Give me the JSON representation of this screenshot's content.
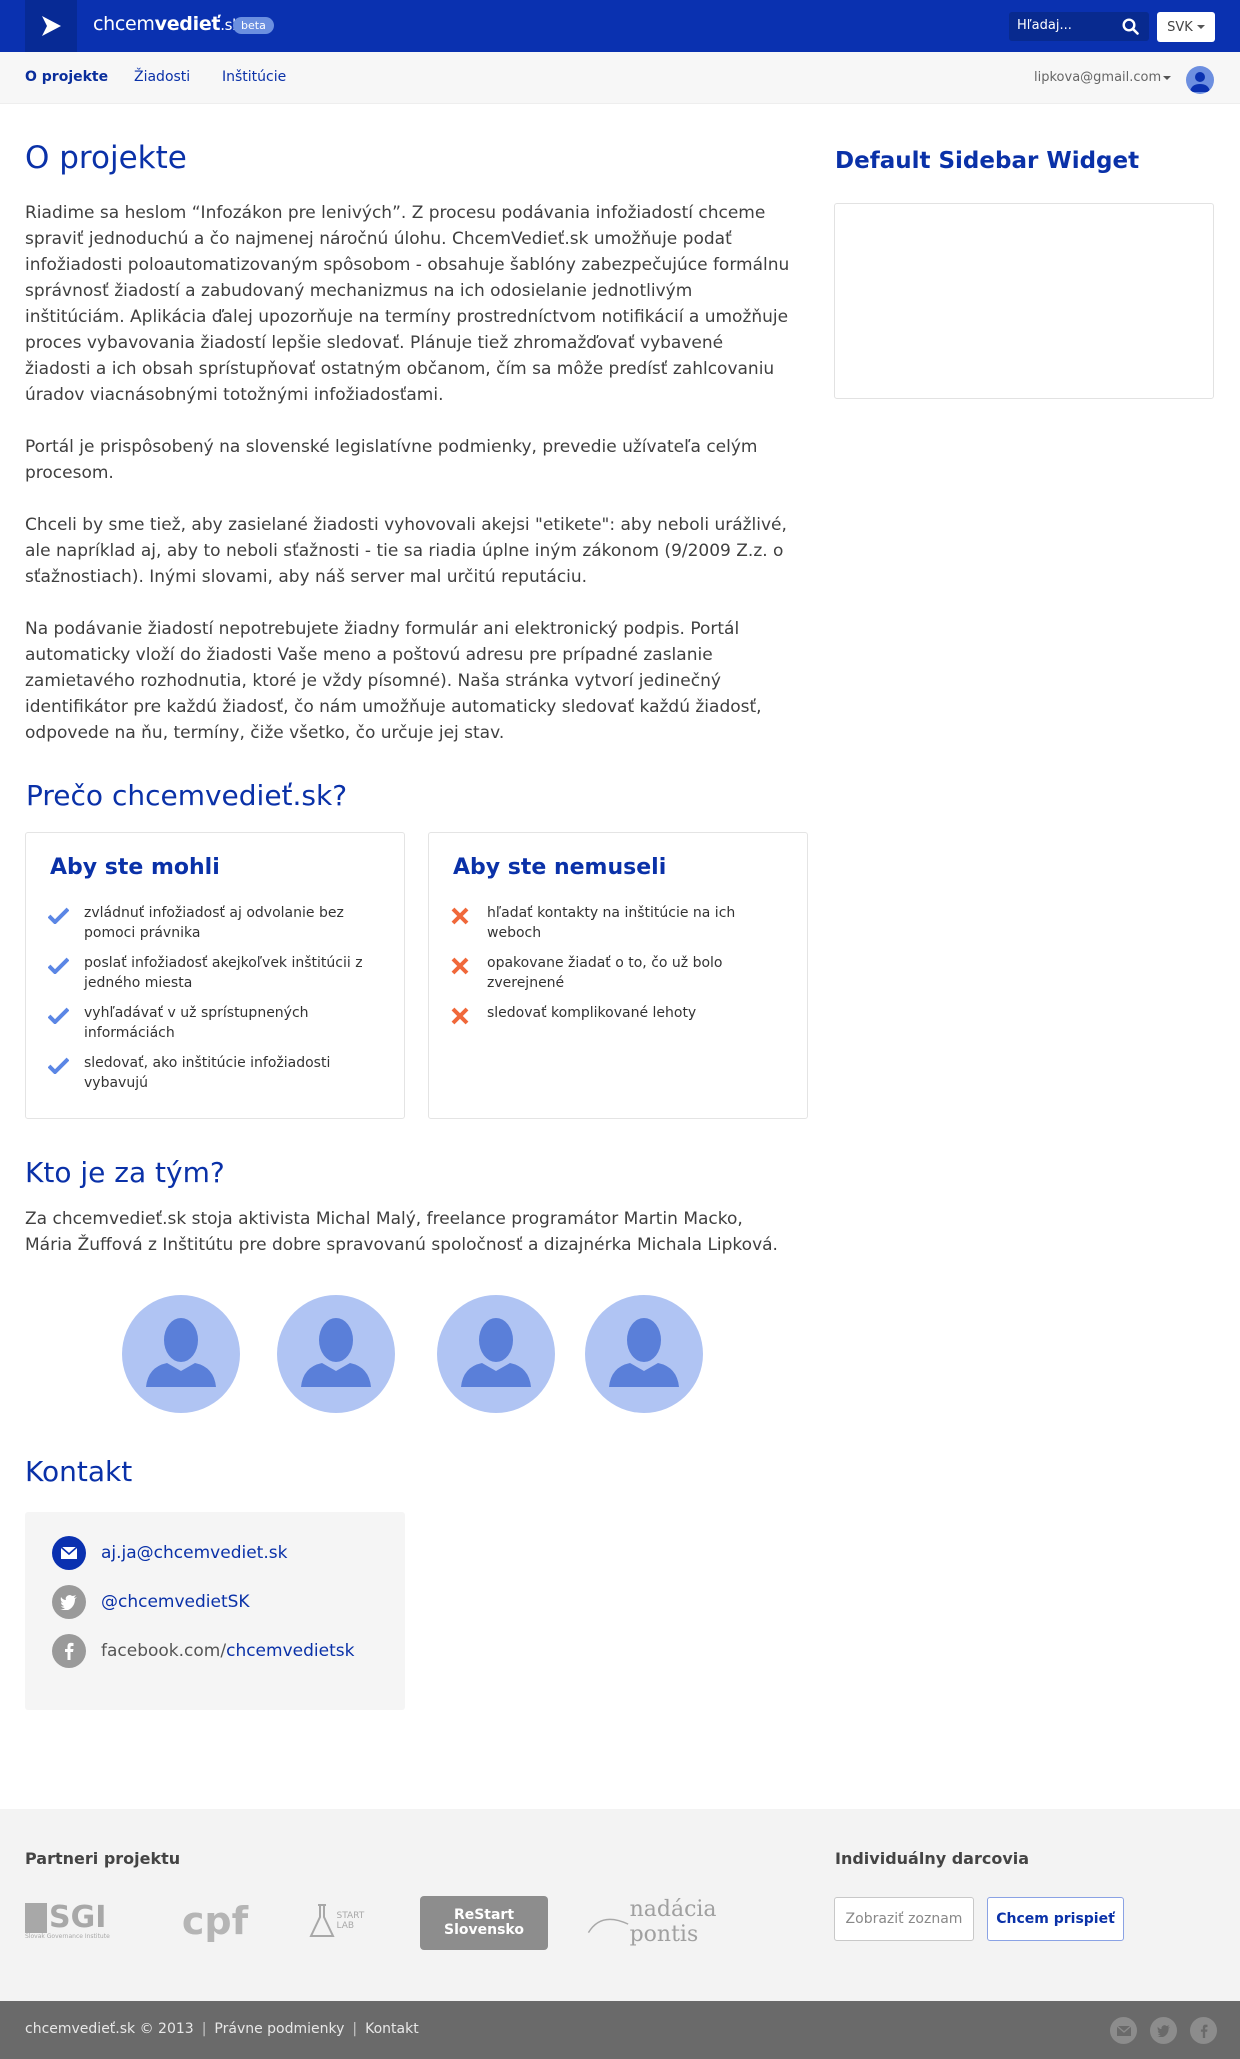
{
  "header": {
    "brand_light": "chcem",
    "brand_bold": "vedieť",
    "brand_tld": ".sk",
    "beta_label": "beta",
    "search_placeholder": "Hľadaj...",
    "lang_label": "SVK"
  },
  "nav": {
    "items": [
      {
        "label": "O projekte",
        "active": true
      },
      {
        "label": "Žiadosti"
      },
      {
        "label": "Inštitúcie"
      }
    ],
    "user_email": "lipkova@gmail.com"
  },
  "main": {
    "title": "O projekte",
    "paragraphs": [
      "Riadime sa heslom “Infozákon pre lenivých”. Z procesu podávania infožiadostí chceme spraviť jednoduchú a čo najmenej náročnú úlohu. ChcemVedieť.sk umožňuje podať infožiadosti poloautomatizovaným spôsobom - obsahuje šablóny zabezpečujúce formálnu správnosť žiadostí a zabudovaný mechanizmus na ich odosielanie jednotlivým inštitúciám. Aplikácia ďalej upozorňuje na termíny prostredníctvom notifikácií a umožňuje proces vybavovania žiadostí lepšie sledovať. Plánuje tiež zhromažďovať vybavené žiadosti a ich obsah sprístupňovať ostatným občanom, čím sa môže predísť zahlcovaniu úradov viacnásobnými totožnými infožiadosťami.",
      "Portál je prispôsobený na slovenské legislatívne podmienky, prevedie užívateľa celým procesom.",
      "Chceli by sme tiež, aby zasielané žiadosti vyhovovali akejsi \"etikete\": aby  neboli urážlivé, ale napríklad aj, aby to neboli sťažnosti - tie sa riadia úplne iným zákonom (9/2009 Z.z. o sťažnostiach). Inými slovami, aby náš server mal určitú reputáciu.",
      "Na podávanie žiadostí nepotrebujete žiadny formulár ani elektronický podpis. Portál automaticky vloží do žiadosti Vaše meno a poštovú adresu pre prípadné zaslanie zamietavého rozhodnutia, ktoré je vždy písomné). Naša stránka vytvorí jedinečný identifikátor pre každú žiadosť, čo nám umožňuje automaticky sledovať každú žiadosť, odpovede na ňu, termíny, čiže všetko, čo určuje jej stav."
    ],
    "why_title": "Prečo chcemvedieť.sk?",
    "can_card": {
      "title": "Aby ste mohli",
      "items": [
        "zvládnuť infožiadosť aj odvolanie bez pomoci právnika",
        "poslať infožiadosť akejkoľvek inštitúcii z jedného miesta",
        "vyhľadávať v už sprístupnených informáciách",
        "sledovať, ako inštitúcie infožiadosti vybavujú"
      ]
    },
    "cannot_card": {
      "title": "Aby ste nemuseli",
      "items": [
        "hľadať kontakty na inštitúcie na ich weboch",
        "opakovane žiadať o to, čo už bolo zverejnené",
        "sledovať komplikované lehoty"
      ]
    },
    "team_title": "Kto je za tým?",
    "team_text": "Za chcemvedieť.sk stoja aktivista Michal Malý, freelance programátor Martin Macko, Mária Žuffová z Inštitútu pre dobre spravovanú spoločnosť a dizajnérka Michala Lipková.",
    "contact_title": "Kontakt",
    "contact": {
      "email": "aj.ja@chcemvediet.sk",
      "twitter": "@chcemvedietSK",
      "facebook_prefix": "facebook.com/",
      "facebook_handle": "chcemvedietsk"
    }
  },
  "sidebar": {
    "title": "Default Sidebar Widget"
  },
  "footer": {
    "partners_title": "Partneri projektu",
    "partners": [
      "SGI",
      "cpf",
      "START LAB",
      "ReStart Slovensko",
      "nadácia pontis"
    ],
    "sgi_sub": "Slovak Governance Institute",
    "donors_title": "Individuálny darcovia",
    "show_list": "Zobraziť zoznam",
    "contribute": "Chcem prispieť",
    "copyright": "chcemvedieť.sk © 2013",
    "legal": "Právne podmienky",
    "contact": "Kontakt"
  },
  "colors": {
    "primary": "#0a31b0",
    "check": "#5b86e5",
    "cross": "#f0683a"
  },
  "icons": [
    "logo-play-icon",
    "search-icon",
    "user-icon",
    "check-icon",
    "cross-icon",
    "mail-icon",
    "twitter-icon",
    "facebook-icon"
  ]
}
